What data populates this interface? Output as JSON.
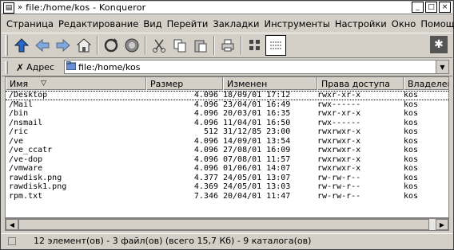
{
  "window": {
    "title": "file:/home/kos - Konqueror",
    "title_marker": "»",
    "buttons": [
      "_",
      "□",
      "×"
    ]
  },
  "menu": [
    "Страница",
    "Редактирование",
    "Вид",
    "Перейти",
    "Закладки",
    "Инструменты",
    "Настройки",
    "Окно",
    "Помощь"
  ],
  "toolbar": {
    "icons": [
      "up-arrow-icon",
      "back-arrow-icon",
      "forward-arrow-icon",
      "home-icon",
      "reload-icon",
      "stop-icon",
      "cut-icon",
      "copy-icon",
      "paste-icon",
      "print-icon",
      "view-mode-icon",
      "view-list-icon"
    ]
  },
  "location": {
    "label": "Адрес",
    "value": "file:/home/kos"
  },
  "columns": {
    "name": "Имя",
    "size": "Размер",
    "modified": "Изменен",
    "perms": "Права доступа",
    "owner": "Владелец"
  },
  "files": [
    {
      "name": "Desktop",
      "size": "4.096",
      "modified": "18/09/01 17:12",
      "perms": "rwxr-xr-x",
      "owner": "kos"
    },
    {
      "name": "Mail",
      "size": "4.096",
      "modified": "23/04/01 16:49",
      "perms": "rwx------",
      "owner": "kos"
    },
    {
      "name": "bin",
      "size": "4.096",
      "modified": "20/03/01 16:35",
      "perms": "rwxr-xr-x",
      "owner": "kos"
    },
    {
      "name": "nsmail",
      "size": "4.096",
      "modified": "11/04/01 16:50",
      "perms": "rwx------",
      "owner": "kos"
    },
    {
      "name": "ric",
      "size": "512",
      "modified": "31/12/85 23:00",
      "perms": "rwxrwxr-x",
      "owner": "kos"
    },
    {
      "name": "ve",
      "size": "4.096",
      "modified": "14/09/01 13:54",
      "perms": "rwxrwxr-x",
      "owner": "kos"
    },
    {
      "name": "ve_ccatr",
      "size": "4.096",
      "modified": "27/08/01 16:09",
      "perms": "rwxrwxr-x",
      "owner": "kos"
    },
    {
      "name": "ve-dop",
      "size": "4.096",
      "modified": "07/08/01 11:57",
      "perms": "rwxrwxr-x",
      "owner": "kos"
    },
    {
      "name": "vmware",
      "size": "4.096",
      "modified": "01/06/01 14:07",
      "perms": "rwxrwxr-x",
      "owner": "kos"
    },
    {
      "name": "rawdisk.png",
      "size": "4.377",
      "modified": "24/05/01 13:07",
      "perms": "rw-rw-r--",
      "owner": "kos"
    },
    {
      "name": "rawdisk1.png",
      "size": "4.369",
      "modified": "24/05/01 13:03",
      "perms": "rw-rw-r--",
      "owner": "kos"
    },
    {
      "name": "rpm.txt",
      "size": "7.346",
      "modified": "20/04/01 11:47",
      "perms": "rw-rw-r--",
      "owner": "kos"
    }
  ],
  "status": {
    "text": "12 элемент(ов) - 3 файл(ов) (всего 15,7 Кб) - 9 каталога(ов)"
  }
}
